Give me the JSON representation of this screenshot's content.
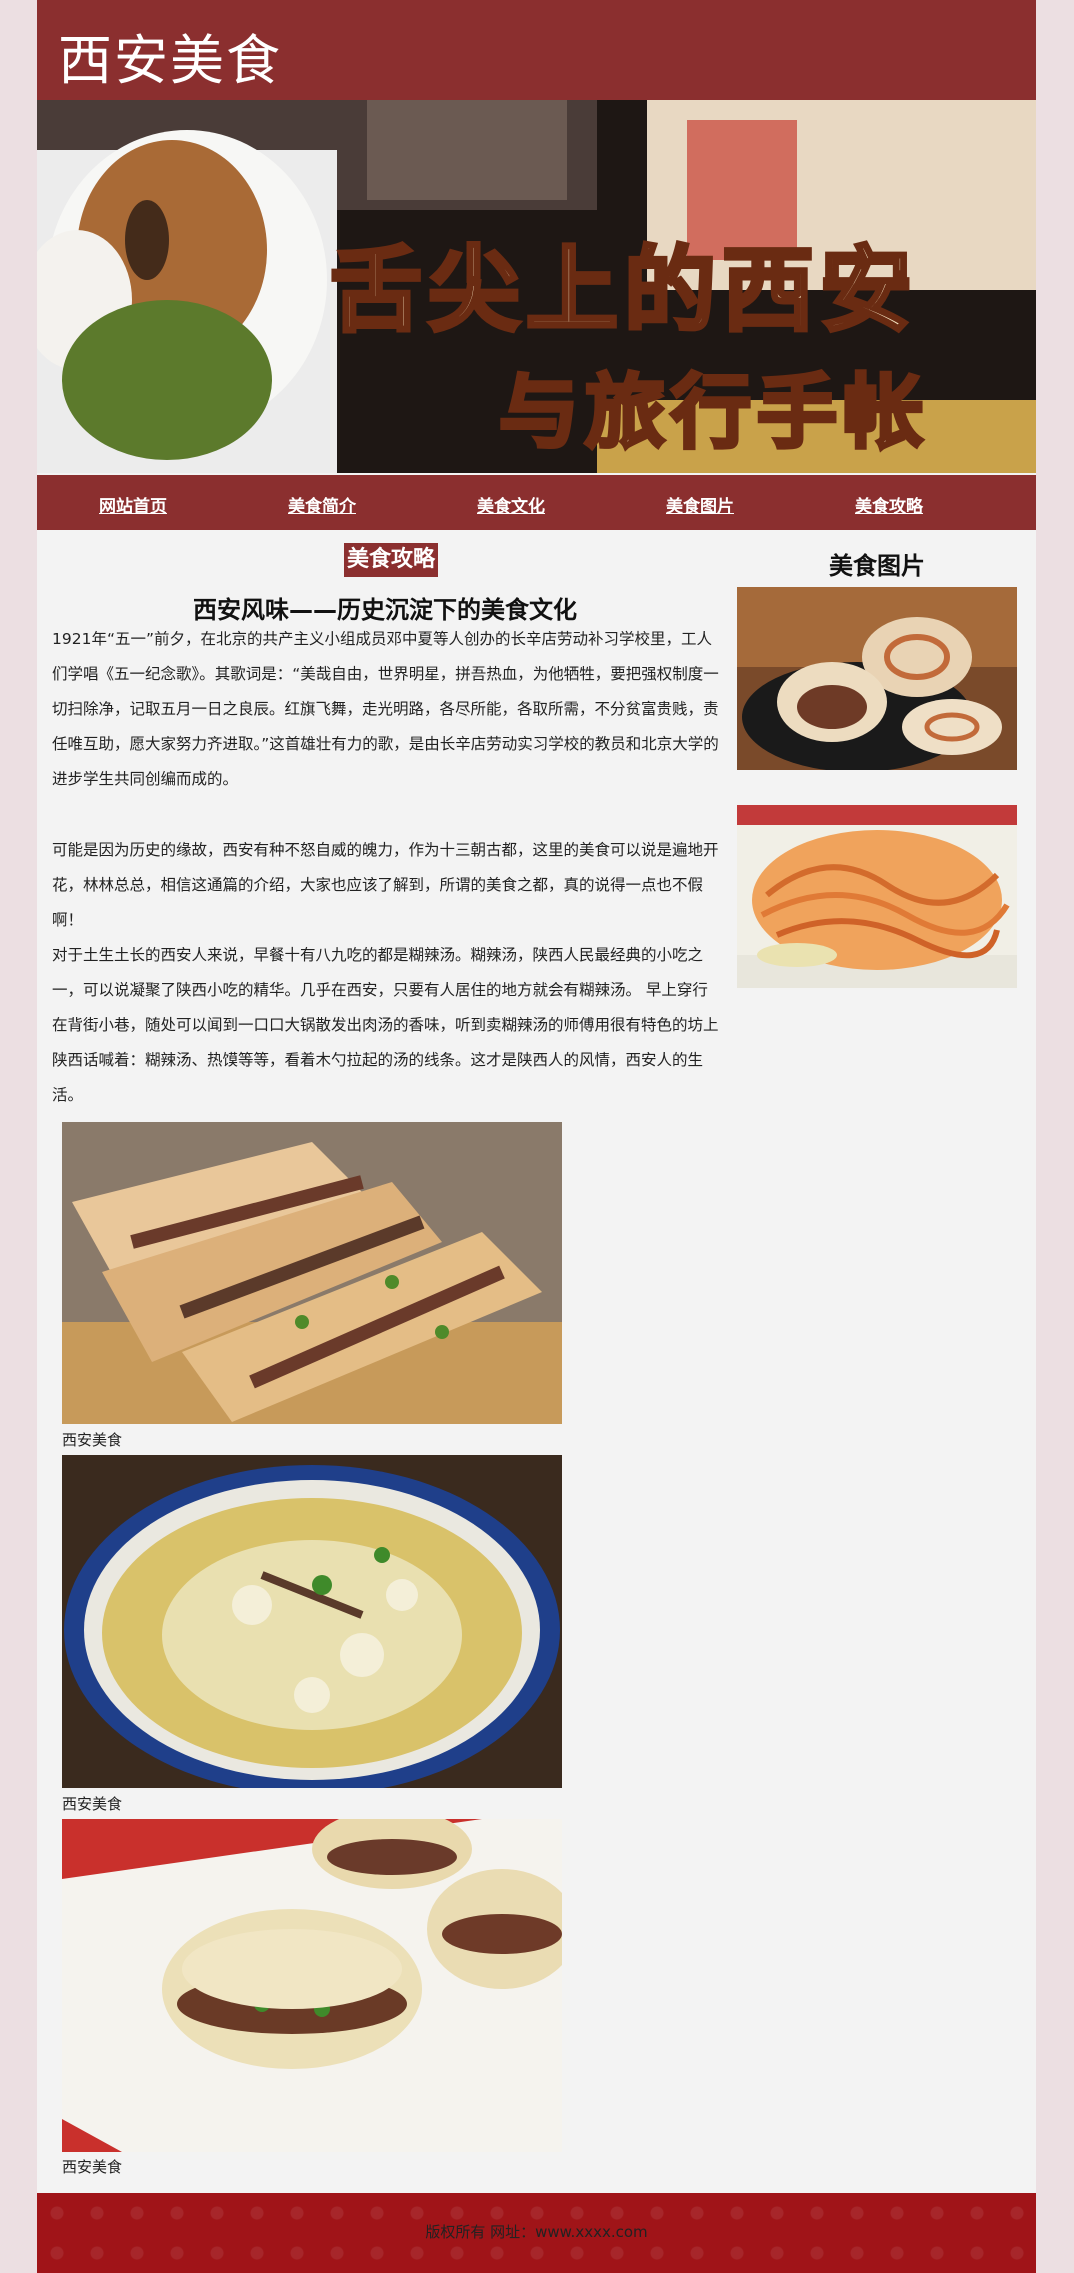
{
  "header": {
    "site_title": "西安美食"
  },
  "banner": {
    "line1": "舌尖上的西安",
    "line2": "与旅行手帐"
  },
  "nav": {
    "items": [
      {
        "label": "网站首页"
      },
      {
        "label": "美食简介"
      },
      {
        "label": "美食文化"
      },
      {
        "label": "美食图片"
      },
      {
        "label": "美食攻略"
      }
    ]
  },
  "main": {
    "tag": "美食攻略",
    "title": "西安风味——历史沉淀下的美食文化",
    "paragraphs": [
      "1921年“五一”前夕，在北京的共产主义小组成员邓中夏等人创办的长辛店劳动补习学校里，工人们学唱《五一纪念歌》。其歌词是：“美哉自由，世界明星，拼吾热血，为他牺牲，要把强权制度一切扫除净，记取五月一日之良辰。红旗飞舞，走光明路，各尽所能，各取所需，不分贫富贵贱，责任唯互助，愿大家努力齐进取。”这首雄壮有力的歌，是由长辛店劳动实习学校的教员和北京大学的进步学生共同创编而成的。",
      "可能是因为历史的缘故，西安有种不怒自威的魄力，作为十三朝古都，这里的美食可以说是遍地开花，林林总总，相信这通篇的介绍，大家也应该了解到，所谓的美食之都，真的说得一点也不假啊！",
      "对于土生土长的西安人来说，早餐十有八九吃的都是糊辣汤。糊辣汤，陕西人民最经典的小吃之一，可以说凝聚了陕西小吃的精华。几乎在西安，只要有人居住的地方就会有糊辣汤。 早上穿行在背街小巷，随处可以闻到一口口大锅散发出肉汤的香味，听到卖糊辣汤的师傅用很有特色的坊上陕西话喊着：糊辣汤、热馍等等，看着木勺拉起的汤的线条。这才是陕西人的风情，西安人的生活。"
    ],
    "photos": [
      {
        "caption": "西安美食"
      },
      {
        "caption": "西安美食"
      },
      {
        "caption": "西安美食"
      }
    ]
  },
  "sidebar": {
    "title": "美食图片"
  },
  "footer": {
    "text": "版权所有 网址：www.xxxx.com"
  }
}
